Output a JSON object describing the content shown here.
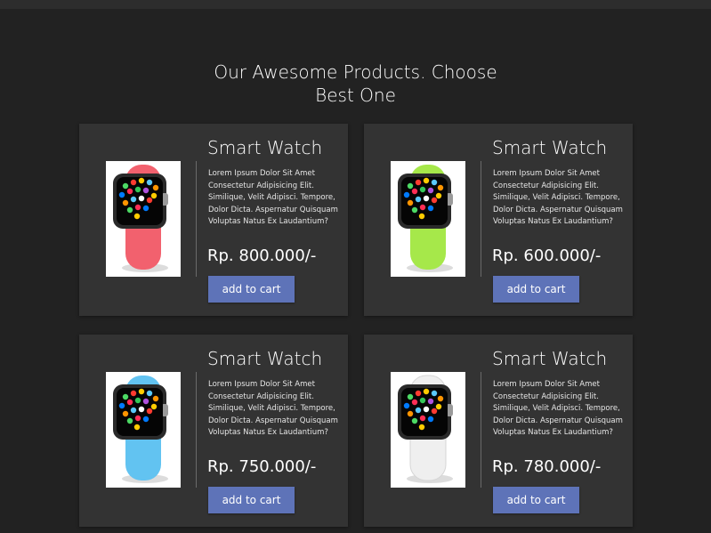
{
  "page": {
    "title_line1": "Our Awesome Products. Choose",
    "title_line2": "Best One"
  },
  "products": [
    {
      "title": "Smart Watch",
      "description": "Lorem Ipsum Dolor Sit Amet Consectetur Adipisicing Elit. Similique, Velit Adipisci. Tempore, Dolor Dicta. Aspernatur Quisquam Voluptas Natus Ex Laudantium?",
      "price": "Rp. 800.000/-",
      "button_label": "add to cart",
      "band_color": "#f2616e",
      "image_icon": "smartwatch-red-icon"
    },
    {
      "title": "Smart Watch",
      "description": "Lorem Ipsum Dolor Sit Amet Consectetur Adipisicing Elit. Similique, Velit Adipisci. Tempore, Dolor Dicta. Aspernatur Quisquam Voluptas Natus Ex Laudantium?",
      "price": "Rp. 600.000/-",
      "button_label": "add to cart",
      "band_color": "#a6e84a",
      "image_icon": "smartwatch-green-icon"
    },
    {
      "title": "Smart Watch",
      "description": "Lorem Ipsum Dolor Sit Amet Consectetur Adipisicing Elit. Similique, Velit Adipisci. Tempore, Dolor Dicta. Aspernatur Quisquam Voluptas Natus Ex Laudantium?",
      "price": "Rp. 750.000/-",
      "button_label": "add to cart",
      "band_color": "#62c3f1",
      "image_icon": "smartwatch-blue-icon"
    },
    {
      "title": "Smart Watch",
      "description": "Lorem Ipsum Dolor Sit Amet Consectetur Adipisicing Elit. Similique, Velit Adipisci. Tempore, Dolor Dicta. Aspernatur Quisquam Voluptas Natus Ex Laudantium?",
      "price": "Rp. 780.000/-",
      "button_label": "add to cart",
      "band_color": "#efefef",
      "image_icon": "smartwatch-white-icon"
    }
  ],
  "colors": {
    "background": "#222222",
    "card": "#333333",
    "button": "#5e73b8"
  }
}
